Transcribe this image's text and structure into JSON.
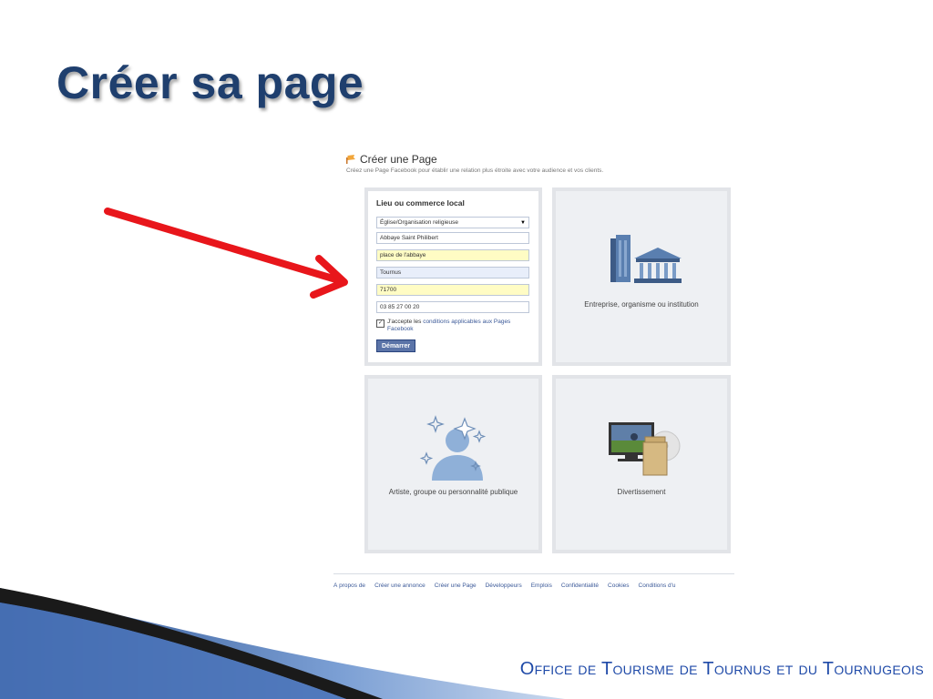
{
  "slide": {
    "title": "Créer sa page",
    "footer": "Office de Tourisme de Tournus et du Tournugeois"
  },
  "fb": {
    "title": "Créer une Page",
    "subtitle": "Créez une Page Facebook pour établir une relation plus étroite avec votre audience et vos clients.",
    "form": {
      "heading": "Lieu ou commerce local",
      "category": "Église/Organisation religieuse",
      "name": "Abbaye Saint Philibert",
      "address": "place de l'abbaye",
      "city": "Tournus",
      "zip": "71700",
      "phone": "03 85 27 00 20",
      "terms_prefix": "J'accepte les",
      "terms_link": "conditions applicables aux Pages Facebook",
      "submit": "Démarrer",
      "terms_checked": true
    },
    "categories": {
      "business": "Entreprise, organisme ou institution",
      "artist": "Artiste, groupe ou personnalité publique",
      "entertainment": "Divertissement"
    },
    "footer_links": [
      "À propos de",
      "Créer une annonce",
      "Créer une Page",
      "Développeurs",
      "Emplois",
      "Confidentialité",
      "Cookies",
      "Conditions d'u"
    ]
  },
  "colors": {
    "title": "#1f3f6e",
    "arrow": "#e8161b",
    "fb_link": "#3b5998",
    "fb_button": "#5b74a8",
    "footer_brand": "#1f4aa8"
  },
  "icons": {
    "header": "flag-icon",
    "business": "buildings-icon",
    "artist": "person-sparkle-icon",
    "entertainment": "tv-film-icon"
  }
}
